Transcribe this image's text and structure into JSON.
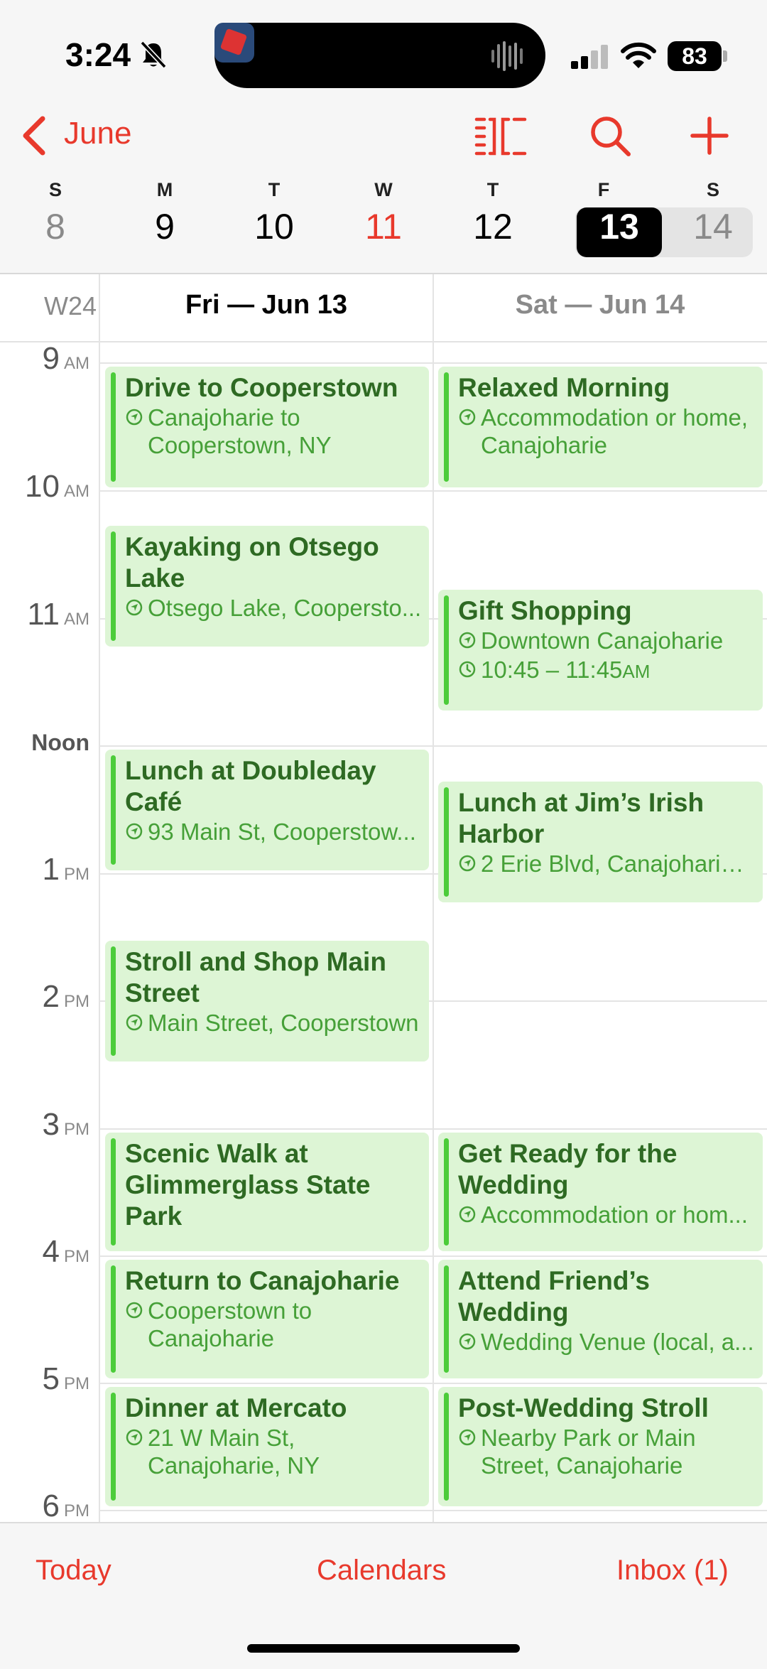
{
  "status": {
    "time": "3:24",
    "battery": "83"
  },
  "header": {
    "back_label": "June",
    "days": [
      {
        "letter": "S",
        "num": "8"
      },
      {
        "letter": "M",
        "num": "9"
      },
      {
        "letter": "T",
        "num": "10"
      },
      {
        "letter": "W",
        "num": "11"
      },
      {
        "letter": "T",
        "num": "12"
      },
      {
        "letter": "F",
        "num": "13"
      },
      {
        "letter": "S",
        "num": "14"
      }
    ]
  },
  "week": {
    "number": "W24",
    "col1": "Fri — Jun 13",
    "col2": "Sat — Jun 14"
  },
  "hours": [
    {
      "n": "9",
      "s": "AM"
    },
    {
      "n": "10",
      "s": "AM"
    },
    {
      "n": "11",
      "s": "AM"
    },
    {
      "noon": "Noon"
    },
    {
      "n": "1",
      "s": "PM"
    },
    {
      "n": "2",
      "s": "PM"
    },
    {
      "n": "3",
      "s": "PM"
    },
    {
      "n": "4",
      "s": "PM"
    },
    {
      "n": "5",
      "s": "PM"
    },
    {
      "n": "6",
      "s": "PM"
    }
  ],
  "events_fri": [
    {
      "title": "Drive to Cooperstown",
      "location": "Canajoharie to Cooperstown, NY"
    },
    {
      "title": "Kayaking on Otsego Lake",
      "location": "Otsego Lake, Coopersto..."
    },
    {
      "title": "Lunch at Doubleday Café",
      "location": "93 Main St, Cooperstow..."
    },
    {
      "title": "Stroll and Shop Main Street",
      "location": "Main Street, Cooperstown"
    },
    {
      "title": "Scenic Walk at Glimmerglass State Park",
      "location": ""
    },
    {
      "title": "Return to Canajoharie",
      "location": "Cooperstown to Canajoharie"
    },
    {
      "title": "Dinner at Mercato",
      "location": "21 W Main St, Canajoharie, NY"
    }
  ],
  "events_sat": [
    {
      "title": "Relaxed Morning",
      "location": "Accommodation or home, Canajoharie"
    },
    {
      "title": "Gift Shopping",
      "location": "Downtown Canajoharie",
      "time": "10:45 – 11:45",
      "time_suffix": "AM"
    },
    {
      "title": "Lunch at Jim’s Irish Harbor",
      "location": "2 Erie Blvd, Canajoharie,..."
    },
    {
      "title": "Get Ready for the Wedding",
      "location": "Accommodation or hom..."
    },
    {
      "title": "Attend Friend’s Wedding",
      "location": "Wedding Venue (local, a..."
    },
    {
      "title": "Post-Wedding Stroll",
      "location": "Nearby Park or Main Street, Canajoharie"
    }
  ],
  "bottom": {
    "today": "Today",
    "calendars": "Calendars",
    "inbox": "Inbox (1)"
  },
  "colors": {
    "accent": "#e8392c",
    "event_bg": "#ddf5d5",
    "event_bar": "#4ccc3a",
    "event_title": "#2e6a23",
    "event_text": "#46a038"
  }
}
